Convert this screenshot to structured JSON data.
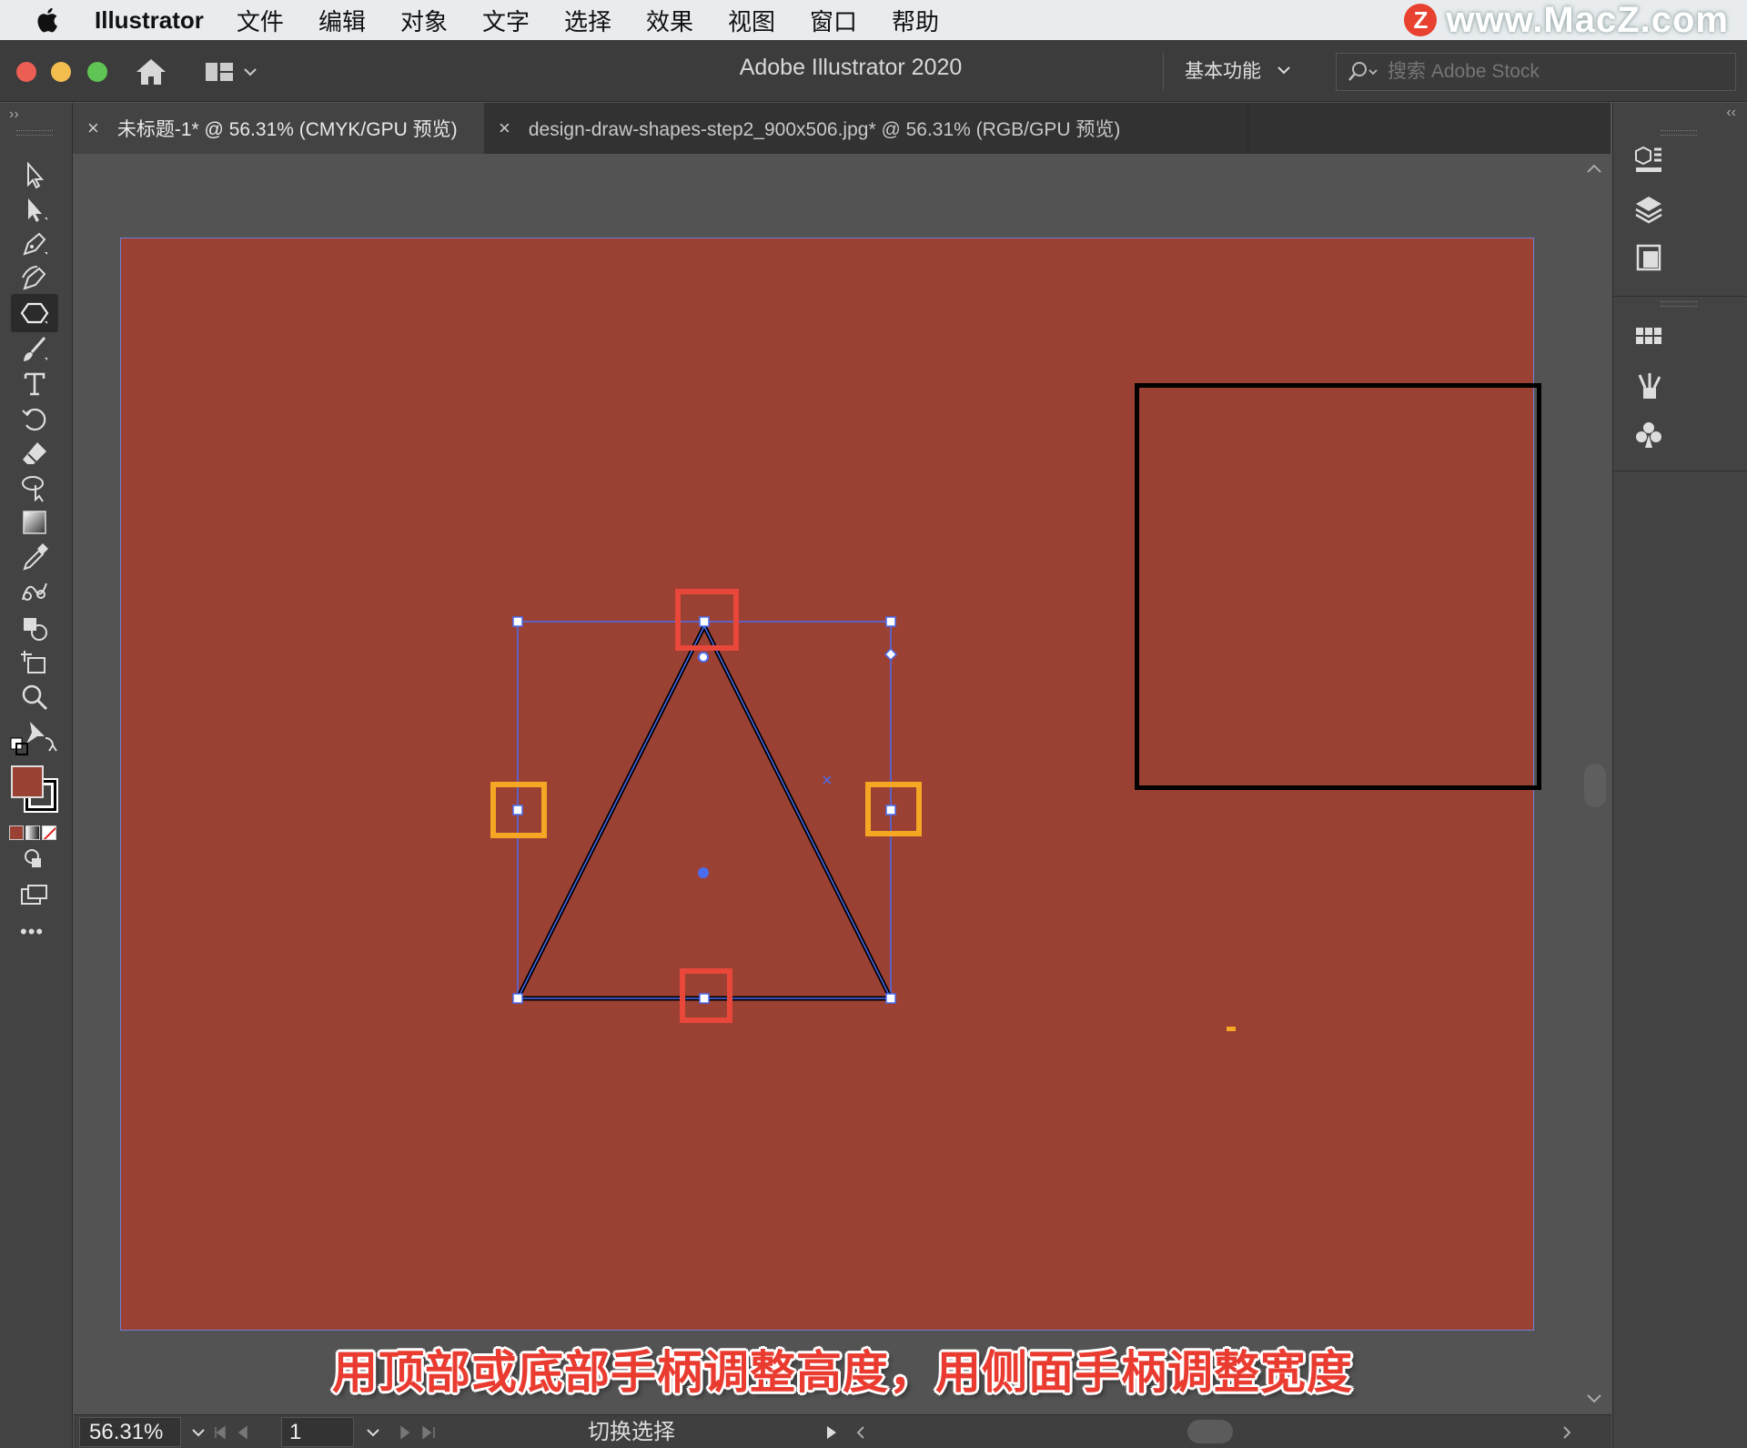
{
  "menubar": {
    "app_name": "Illustrator",
    "items": [
      "文件",
      "编辑",
      "对象",
      "文字",
      "选择",
      "效果",
      "视图",
      "窗口",
      "帮助"
    ],
    "watermark": "www.MacZ.com",
    "watermark_badge": "Z"
  },
  "titlebar": {
    "title": "Adobe Illustrator 2020",
    "workspace": "基本功能",
    "stock_search_placeholder": "搜索 Adobe Stock"
  },
  "tabs": [
    {
      "label": "未标题-1* @ 56.31% (CMYK/GPU 预览)",
      "close": "×"
    },
    {
      "label": "design-draw-shapes-step2_900x506.jpg* @ 56.31% (RGB/GPU 预览)",
      "close": "×"
    }
  ],
  "canvas": {
    "artboard_color": "#9b4134",
    "highlight_red": "#e8473a",
    "highlight_orange": "#f5a623",
    "selection_color": "#4a6cf0"
  },
  "caption": "用顶部或底部手柄调整高度，用侧面手柄调整宽度",
  "statusbar": {
    "zoom": "56.31%",
    "page": "1",
    "toggle_label": "切换选择"
  },
  "toolbar": {
    "collapse": "››",
    "more": "•••",
    "tools": [
      "selection-tool",
      "direct-selection-tool",
      "pen-tool",
      "curvature-tool",
      "polygon-tool",
      "paintbrush-tool",
      "type-tool",
      "rotate-tool",
      "eraser-tool",
      "lasso-tool",
      "gradient-tool",
      "eyedropper-tool",
      "blend-tool",
      "shape-builder-tool",
      "artboard-tool",
      "zoom-tool",
      "puppet-warp-tool"
    ]
  },
  "rightpanel": {
    "collapse": "‹‹",
    "icons": [
      "properties-icon",
      "layers-icon",
      "libraries-icon",
      "swatches-icon",
      "brushes-icon",
      "symbols-icon"
    ]
  }
}
